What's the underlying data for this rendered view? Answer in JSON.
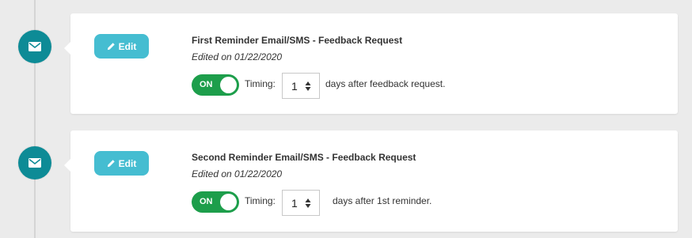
{
  "reminders": [
    {
      "edit_label": "Edit",
      "title": "First Reminder Email/SMS - Feedback Request",
      "edited": "Edited on 01/22/2020",
      "toggle_label": "ON",
      "timing_label": "Timing:",
      "timing_value": "1",
      "after_text": "days after feedback request."
    },
    {
      "edit_label": "Edit",
      "title": "Second Reminder Email/SMS - Feedback Request",
      "edited": "Edited on 01/22/2020",
      "toggle_label": "ON",
      "timing_label": "Timing:",
      "timing_value": "1",
      "after_text": "days after 1st reminder."
    }
  ],
  "icons": {
    "node": "envelope-icon",
    "edit": "pencil-icon",
    "stepper": "stepper-arrows-icon"
  },
  "colors": {
    "node_teal": "#0d8b96",
    "edit_button": "#45bdd1",
    "toggle_on": "#1d9e4b",
    "background": "#ebebeb"
  }
}
